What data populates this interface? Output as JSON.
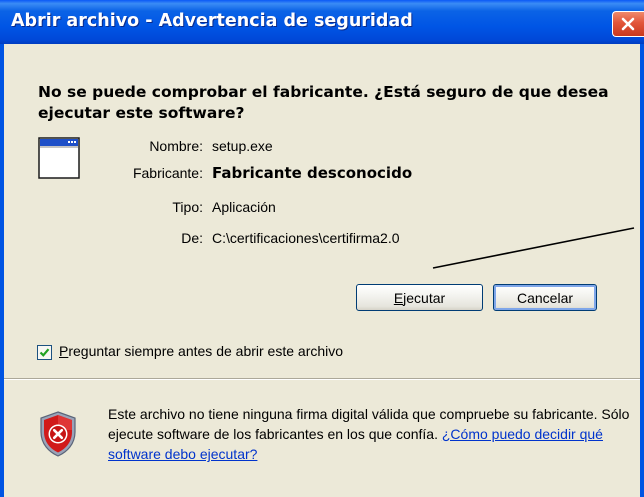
{
  "window": {
    "title": "Abrir archivo - Advertencia de seguridad"
  },
  "headline": "No se puede comprobar el fabricante. ¿Está seguro de que desea ejecutar este software?",
  "details": {
    "name_label": "Nombre:",
    "name_value": "setup.exe",
    "publisher_label": "Fabricante:",
    "publisher_value": "Fabricante desconocido",
    "type_label": "Tipo:",
    "type_value": "Aplicación",
    "from_label": "De:",
    "from_value": "C:\\certificaciones\\certifirma2.0"
  },
  "buttons": {
    "run_mnemonic": "E",
    "run_rest": "jecutar",
    "cancel": "Cancelar"
  },
  "checkbox": {
    "checked": true,
    "label_mnemonic": "P",
    "label_rest": "reguntar siempre antes de abrir este archivo"
  },
  "warning": {
    "text": "Este archivo no tiene ninguna firma digital válida que compruebe su fabricante.  Sólo ejecute software de los fabricantes en los que confía.",
    "link": "¿Cómo puedo decidir qué software debo ejecutar?"
  },
  "icons": {
    "app": "application-window-icon",
    "shield": "security-shield-icon",
    "close": "close-icon",
    "check": "checkmark-icon"
  },
  "colors": {
    "titlebar": "#0055e5",
    "dialog_bg": "#ece9d8",
    "close_button": "#e2553a",
    "link": "#0033cc",
    "shield_red": "#d11a1a"
  }
}
